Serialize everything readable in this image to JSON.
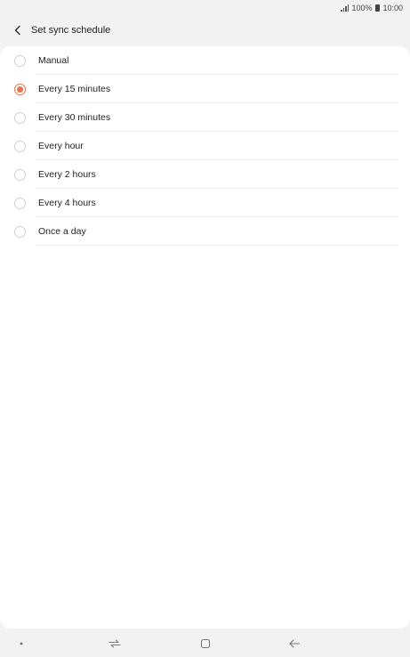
{
  "status_bar": {
    "battery": "100%",
    "time": "10:00"
  },
  "header": {
    "title": "Set sync schedule",
    "back_icon": "chevron-left-icon"
  },
  "sync_options": [
    {
      "label": "Manual",
      "selected": false
    },
    {
      "label": "Every 15 minutes",
      "selected": true
    },
    {
      "label": "Every 30 minutes",
      "selected": false
    },
    {
      "label": "Every hour",
      "selected": false
    },
    {
      "label": "Every 2 hours",
      "selected": false
    },
    {
      "label": "Every 4 hours",
      "selected": false
    },
    {
      "label": "Once a day",
      "selected": false
    }
  ],
  "nav_bar": {
    "items": [
      "dot-icon",
      "recent-apps-icon",
      "home-icon",
      "back-arrow-icon"
    ]
  },
  "colors": {
    "accent": "#e2734e",
    "background": "#f2f2f2",
    "card": "#ffffff"
  }
}
